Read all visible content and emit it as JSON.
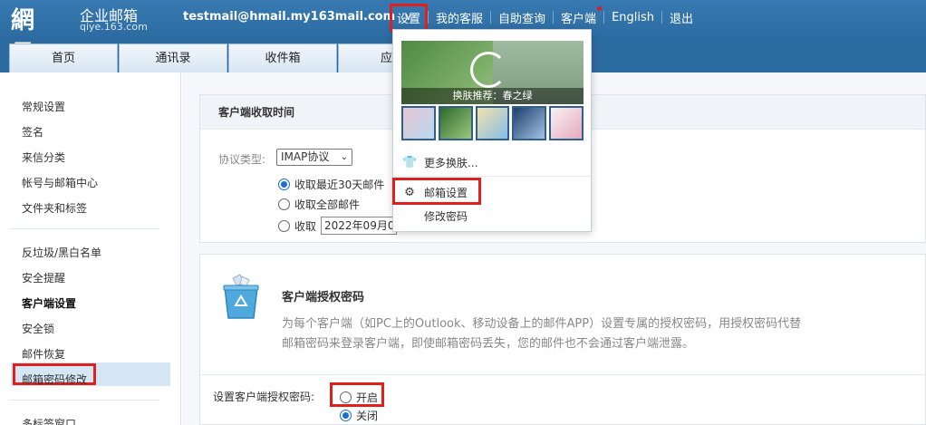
{
  "header": {
    "brand": "網易",
    "product_name": "企业邮箱",
    "domain": "qiye.163.com",
    "account": "testmail@hmail.my163mail.com",
    "account_caret": "∨",
    "links": [
      "设置",
      "我的客服",
      "自助查询",
      "客户端",
      "English",
      "退出"
    ],
    "tabs": [
      "首页",
      "通讯录",
      "收件箱",
      "应用"
    ]
  },
  "sidebar": {
    "group1": [
      "常规设置",
      "签名",
      "来信分类",
      "帐号与邮箱中心",
      "文件夹和标签"
    ],
    "group2": [
      "反垃圾/黑白名单",
      "安全提醒",
      "客户端设置",
      "安全锁",
      "邮件恢复",
      "邮箱密码修改"
    ],
    "group3": [
      "多标签窗口"
    ]
  },
  "main": {
    "panel1": {
      "title": "客户端收取时间",
      "protocol_label": "协议类型:",
      "protocol_value": "IMAP协议",
      "opt_recent": "收取最近30天邮件",
      "opt_all": "收取全部邮件",
      "opt_since": "收取",
      "since_date": "2022年09月0"
    },
    "panel2": {
      "title": "客户端授权密码",
      "desc": "为每个客户端（如PC上的Outlook、移动设备上的邮件APP）设置专属的授权密码，用授权密码代替邮箱密码来登录客户端，即使邮箱密码丢失，您的邮件也不会通过客户端泄露。",
      "pw_label": "设置客户端授权密码:",
      "opt_on": "开启",
      "opt_off": "关闭"
    }
  },
  "dropdown": {
    "theme_caption": "换肤推荐：春之绿",
    "more_skins": "更多换肤...",
    "mail_settings": "邮箱设置",
    "change_password": "修改密码"
  },
  "colors": {
    "header_blue": "#2c6ba0",
    "highlight_red": "#e0201c",
    "active_bg": "#d6e6f5"
  }
}
